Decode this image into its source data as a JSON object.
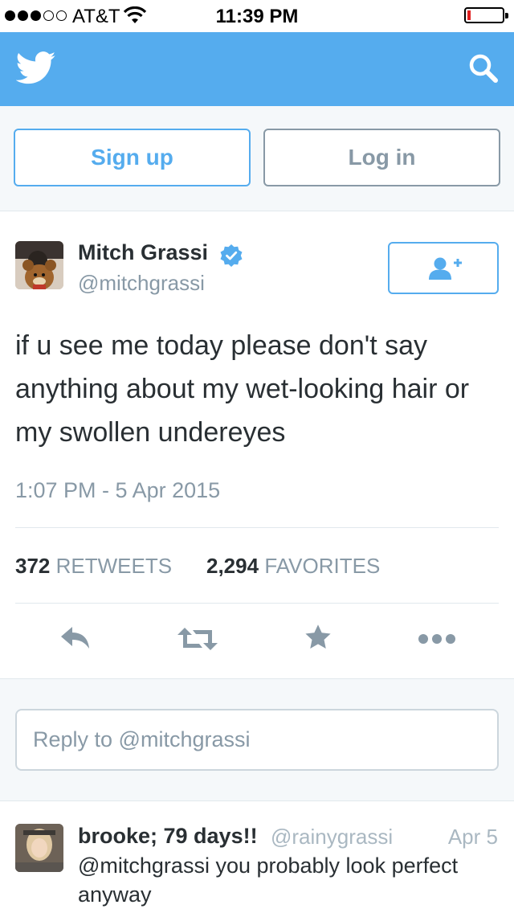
{
  "status_bar": {
    "carrier": "AT&T",
    "time": "11:39 PM",
    "signal_bars_filled": 3,
    "signal_bars_total": 5,
    "battery_level": 0.05
  },
  "header": {
    "logo_icon": "twitter-bird-icon",
    "search_icon": "search-icon",
    "background_color": "#55acee"
  },
  "auth": {
    "signup_label": "Sign up",
    "login_label": "Log in"
  },
  "tweet": {
    "author_name": "Mitch Grassi",
    "verified": true,
    "handle": "@mitchgrassi",
    "text": "if u see me today please don't say anything about my wet-looking hair or my swollen undereyes",
    "timestamp": "1:07 PM - 5 Apr 2015",
    "retweets_count": "372",
    "retweets_label": "RETWEETS",
    "favorites_count": "2,294",
    "favorites_label": "FAVORITES",
    "actions": [
      "reply-icon",
      "retweet-icon",
      "favorite-star-icon",
      "more-icon"
    ]
  },
  "reply_box": {
    "placeholder": "Reply to @mitchgrassi"
  },
  "reply": {
    "author_name": "brooke; 79 days!!",
    "handle": "@rainygrassi",
    "date": "Apr 5",
    "text": "@mitchgrassi you probably look perfect anyway"
  }
}
